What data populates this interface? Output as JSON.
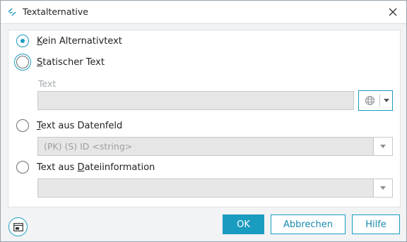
{
  "window": {
    "title": "Textalternative"
  },
  "options": {
    "none": {
      "label_accel": "K",
      "label_rest": "ein Alternativtext",
      "checked": true
    },
    "static": {
      "label_accel": "S",
      "label_rest": "tatischer Text",
      "checked": false
    },
    "datafield": {
      "label_accel": "T",
      "label_rest": "ext aus Datenfeld",
      "checked": false
    },
    "fileinfo": {
      "label_pre": "Text aus ",
      "label_accel": "D",
      "label_rest": "ateiinformation",
      "checked": false
    }
  },
  "static_text": {
    "field_label": "Text",
    "value": ""
  },
  "datafield_select": {
    "value": "(PK) (S) ID <string>"
  },
  "fileinfo_select": {
    "value": ""
  },
  "buttons": {
    "ok": "OK",
    "cancel": "Abbrechen",
    "help": "Hilfe"
  },
  "colors": {
    "accent": "#1a9bc0",
    "disabled_fill": "#e6e6e6",
    "dialog_bg": "#f1f3f4"
  },
  "icons": {
    "app": "text-alternative-app-icon",
    "close": "close-icon",
    "language": "globe-icon",
    "dropdown": "chevron-down-icon",
    "window_mode": "window-layout-icon"
  }
}
